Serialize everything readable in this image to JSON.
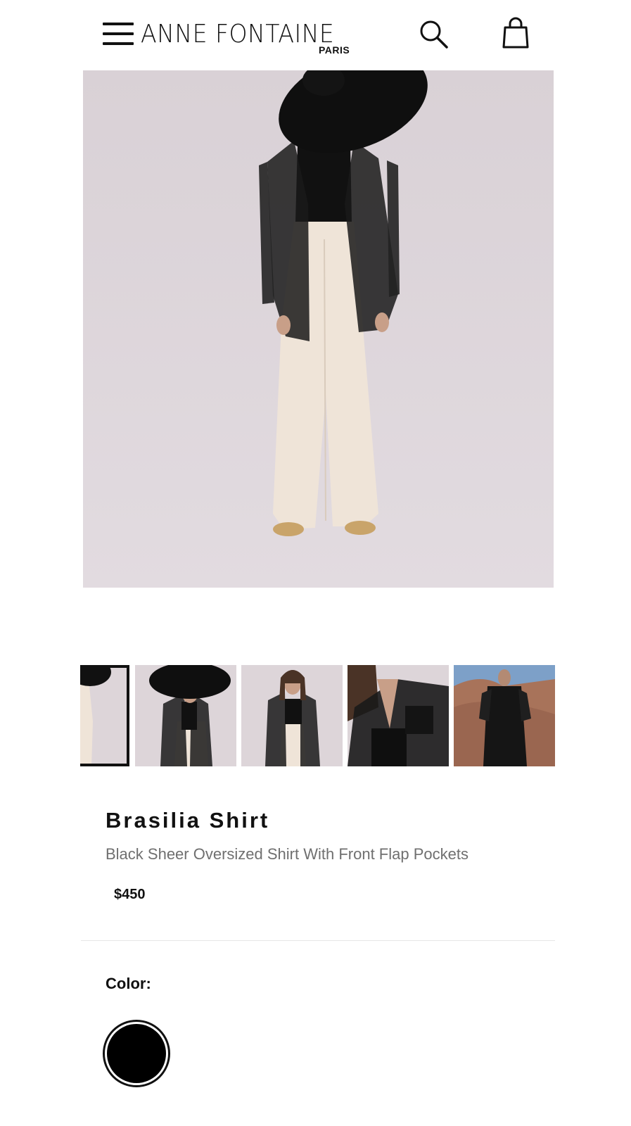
{
  "header": {
    "brand_name": "ANNE FONTAINE",
    "brand_sub": "PARIS",
    "menu_icon": "hamburger-menu-icon",
    "search_icon": "search-icon",
    "bag_icon": "shopping-bag-icon"
  },
  "gallery": {
    "main_image_alt": "Brasilia Shirt",
    "thumbnail_count": 5,
    "selected_thumbnail": 0
  },
  "product": {
    "title": "Brasilia Shirt",
    "subtitle": "Black Sheer Oversized Shirt With Front Flap Pockets",
    "price": "$450"
  },
  "options": {
    "color_label": "Color:",
    "selected_color": "#000000"
  },
  "colors": {
    "text": "#111111",
    "subtitle": "#6f6f6f",
    "image_background": "#ddd5d9"
  }
}
